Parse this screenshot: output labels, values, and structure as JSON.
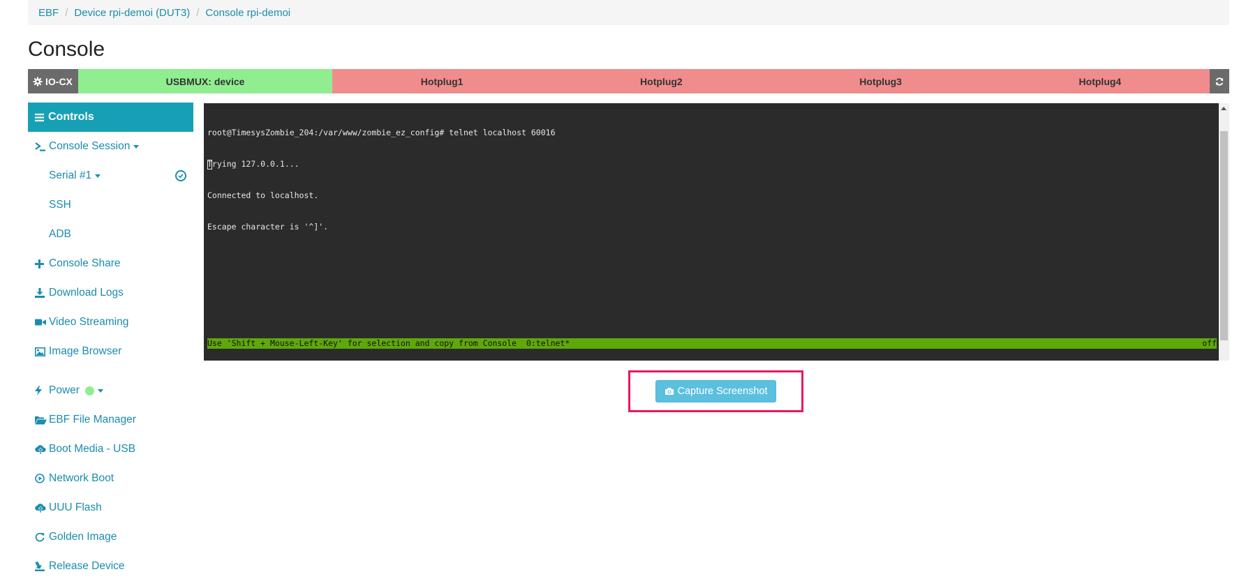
{
  "breadcrumb": {
    "items": [
      "EBF",
      "Device rpi-demoi (DUT3)",
      "Console rpi-demoi"
    ],
    "separator": "/"
  },
  "page_title": "Console",
  "io_bar": {
    "label": "IO-CX",
    "usbmux": "USBMUX: device",
    "hotplugs": [
      "Hotplug1",
      "Hotplug2",
      "Hotplug3",
      "Hotplug4"
    ],
    "colors": {
      "usbmux": "#90ee90",
      "hotplug": "#f08c8c",
      "label": "#6b6b6b"
    }
  },
  "sidebar": {
    "header": "Controls",
    "console_session": "Console Session",
    "serial": "Serial #1",
    "ssh": "SSH",
    "adb": "ADB",
    "console_share": "Console Share",
    "download_logs": "Download Logs",
    "video_streaming": "Video Streaming",
    "image_browser": "Image Browser",
    "power": "Power",
    "ebf_file_manager": "EBF File Manager",
    "boot_media_usb": "Boot Media - USB",
    "network_boot": "Network Boot",
    "uuu_flash": "UUU Flash",
    "golden_image": "Golden Image",
    "release_device": "Release Device",
    "accent_color": "#17a0b5"
  },
  "console": {
    "lines": [
      "root@TimesysZombie_204:/var/www/zombie_ez_config# telnet localhost 60016",
      "Trying 127.0.0.1...",
      "Connected to localhost.",
      "Escape character is '^]'."
    ],
    "status_left": "Use 'Shift + Mouse-Left-Key' for selection and copy from Console  0:telnet*",
    "status_right": "off"
  },
  "capture_button": {
    "label": "Capture Screenshot"
  }
}
